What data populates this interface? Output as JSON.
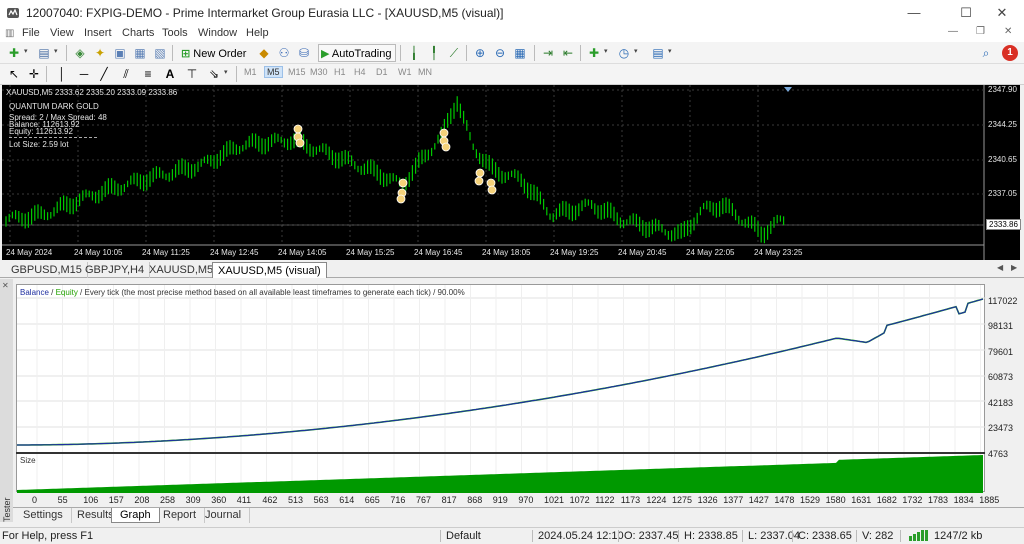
{
  "window": {
    "title": "12007040: FXPIG-DEMO - Prime Intermarket Group Eurasia LLC - [XAUUSD,M5 (visual)]",
    "controls": [
      "—",
      "☐",
      "✕"
    ]
  },
  "menu": [
    "File",
    "View",
    "Insert",
    "Charts",
    "Tools",
    "Window",
    "Help"
  ],
  "toolbar": {
    "new_order": "New Order",
    "autotrading": "AutoTrading",
    "notif_count": "1"
  },
  "timeframes": [
    "M1",
    "M5",
    "M15",
    "M30",
    "H1",
    "H4",
    "D1",
    "W1",
    "MN"
  ],
  "active_timeframe": "M5",
  "chart": {
    "header": "XAUUSD,M5  2333.62 2335.20 2333.09 2333.86",
    "ea_name": "QUANTUM DARK GOLD",
    "spread": "Spread:  2 / Max Spread: 48",
    "balance": "Balance:   112613.92",
    "equity": "Equity:    112613.92",
    "lot_size": "Lot Size:   2.59 lot",
    "price_labels": [
      "2347.90",
      "2344.25",
      "2340.65",
      "2337.05",
      "2333.86"
    ],
    "current_price": "2333.86",
    "time_labels": [
      "24 May 2024",
      "24 May 10:05",
      "24 May 11:25",
      "24 May 12:45",
      "24 May 14:05",
      "24 May 15:25",
      "24 May 16:45",
      "24 May 18:05",
      "24 May 19:25",
      "24 May 20:45",
      "24 May 22:05",
      "24 May 23:25"
    ],
    "colors": {
      "bg": "#000000",
      "candle": "#00c800",
      "grid": "#3a3a3a",
      "text": "#e6e6e6"
    }
  },
  "chart_tabs": [
    "GBPUSD,M15",
    "GBPJPY,H4",
    "XAUUSD,M5",
    "XAUUSD,M5 (visual)"
  ],
  "active_chart_tab": "XAUUSD,M5 (visual)",
  "graph": {
    "legend_balance": "Balance",
    "legend_sep": " / ",
    "legend_equity": "Equity",
    "legend_rest": " / Every tick (the most precise method based on all available least timeframes to generate each tick) / 90.00%",
    "size_label": "Size",
    "y_labels": [
      "117022",
      "98131",
      "79601",
      "60873",
      "42183",
      "23473",
      "4763"
    ],
    "x_labels": [
      "0",
      "55",
      "106",
      "157",
      "208",
      "258",
      "309",
      "360",
      "411",
      "462",
      "513",
      "563",
      "614",
      "665",
      "716",
      "767",
      "817",
      "868",
      "919",
      "970",
      "1021",
      "1072",
      "1122",
      "1173",
      "1224",
      "1275",
      "1326",
      "1377",
      "1427",
      "1478",
      "1529",
      "1580",
      "1631",
      "1682",
      "1732",
      "1783",
      "1834",
      "1885"
    ],
    "colors": {
      "balance": "#1f2fa0",
      "equity": "#22c000",
      "size": "#009900"
    }
  },
  "tester_label": "Tester",
  "bottom_tabs": [
    "Settings",
    "Results",
    "Graph",
    "Report",
    "Journal"
  ],
  "active_bottom_tab": "Graph",
  "status": {
    "help": "For Help, press F1",
    "profile": "Default",
    "datetime": "2024.05.24 12:10",
    "open": "O: 2337.45",
    "high": "H: 2338.85",
    "low": "L: 2337.04",
    "close": "C: 2338.65",
    "volume": "V: 282",
    "traffic": "1247/2 kb"
  }
}
